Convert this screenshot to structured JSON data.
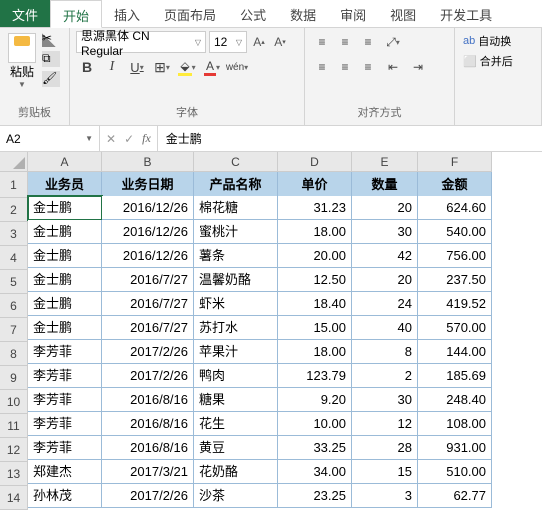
{
  "tabs": {
    "file": "文件",
    "home": "开始",
    "insert": "插入",
    "layout": "页面布局",
    "formula": "公式",
    "data": "数据",
    "review": "审阅",
    "view": "视图",
    "dev": "开发工具"
  },
  "ribbon": {
    "paste": "粘贴",
    "clipboard_label": "剪贴板",
    "font_name": "思源黑体 CN Regular",
    "font_size": "12",
    "font_label": "字体",
    "align_label": "对齐方式",
    "wrap": "自动换",
    "merge": "合并后"
  },
  "namebox": "A2",
  "formula_value": "金士鹏",
  "columns": [
    "A",
    "B",
    "C",
    "D",
    "E",
    "F"
  ],
  "headers": [
    "业务员",
    "业务日期",
    "产品名称",
    "单价",
    "数量",
    "金额"
  ],
  "rows": [
    [
      "金士鹏",
      "2016/12/26",
      "棉花糖",
      "31.23",
      "20",
      "624.60"
    ],
    [
      "金士鹏",
      "2016/12/26",
      "蜜桃汁",
      "18.00",
      "30",
      "540.00"
    ],
    [
      "金士鹏",
      "2016/12/26",
      "薯条",
      "20.00",
      "42",
      "756.00"
    ],
    [
      "金士鹏",
      "2016/7/27",
      "温馨奶酪",
      "12.50",
      "20",
      "237.50"
    ],
    [
      "金士鹏",
      "2016/7/27",
      "虾米",
      "18.40",
      "24",
      "419.52"
    ],
    [
      "金士鹏",
      "2016/7/27",
      "苏打水",
      "15.00",
      "40",
      "570.00"
    ],
    [
      "李芳菲",
      "2017/2/26",
      "苹果汁",
      "18.00",
      "8",
      "144.00"
    ],
    [
      "李芳菲",
      "2017/2/26",
      "鸭肉",
      "123.79",
      "2",
      "185.69"
    ],
    [
      "李芳菲",
      "2016/8/16",
      "糖果",
      "9.20",
      "30",
      "248.40"
    ],
    [
      "李芳菲",
      "2016/8/16",
      "花生",
      "10.00",
      "12",
      "108.00"
    ],
    [
      "李芳菲",
      "2016/8/16",
      "黄豆",
      "33.25",
      "28",
      "931.00"
    ],
    [
      "郑建杰",
      "2017/3/21",
      "花奶酪",
      "34.00",
      "15",
      "510.00"
    ],
    [
      "孙林茂",
      "2017/2/26",
      "沙茶",
      "23.25",
      "3",
      "62.77"
    ]
  ]
}
